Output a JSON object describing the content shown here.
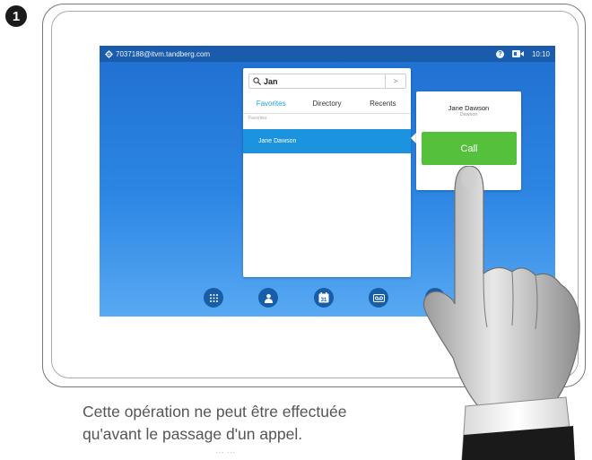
{
  "step_number": "1",
  "status_bar": {
    "address": "7037188@itvm.tandberg.com",
    "help_glyph": "?",
    "time": "10:10"
  },
  "search": {
    "value": "Jan",
    "go_glyph": ">"
  },
  "tabs": [
    {
      "label": "Favorites",
      "active": true
    },
    {
      "label": "Directory",
      "active": false
    },
    {
      "label": "Recents",
      "active": false
    }
  ],
  "section_label": "Favorites",
  "selected_contact": "Jane Dawson",
  "contact_card": {
    "name": "Jane Dawson",
    "subtitle": "Dawson",
    "call_label": "Call",
    "more_label": "•••"
  },
  "dock": {
    "calendar_day": "31",
    "icons": [
      "keypad-icon",
      "contacts-icon",
      "calendar-icon",
      "voicemail-icon",
      "share-icon"
    ]
  },
  "caption": {
    "line1": "Cette opération ne peut être effectuée",
    "line2": "qu'avant le passage d'un appel.",
    "line3": "… … …"
  },
  "colors": {
    "screen_top": "#1f6fd0",
    "accent_tab": "#1ea3e6",
    "selected_row": "#1c93df",
    "call_green": "#54c03c",
    "dock_button": "#185ea6"
  }
}
